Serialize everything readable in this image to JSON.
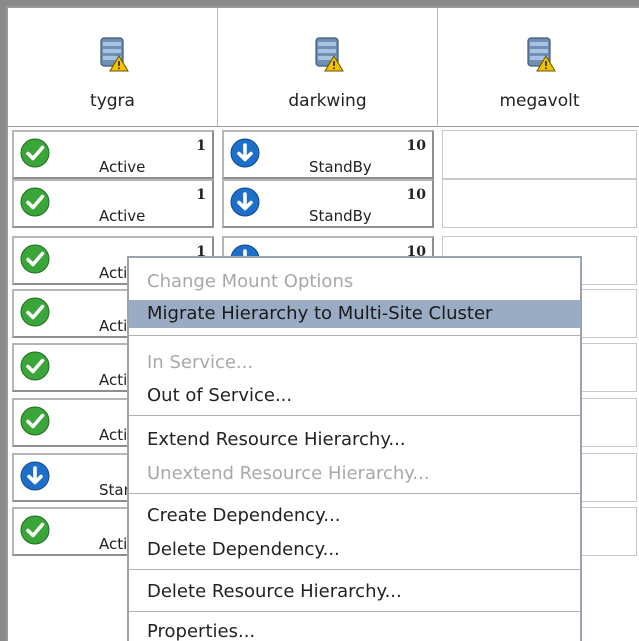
{
  "servers": [
    {
      "name": "tygra",
      "icon": "server-warning-icon"
    },
    {
      "name": "darkwing",
      "icon": "server-warning-icon"
    },
    {
      "name": "megavolt",
      "icon": "server-warning-icon"
    }
  ],
  "rows": [
    {
      "tygra": {
        "state": "Active",
        "priority": "1",
        "icon": "check-icon"
      },
      "darkwing": {
        "state": "StandBy",
        "priority": "10",
        "icon": "arrow-down-icon"
      }
    },
    {
      "tygra": {
        "state": "Active",
        "priority": "1",
        "icon": "check-icon"
      },
      "darkwing": {
        "state": "StandBy",
        "priority": "10",
        "icon": "arrow-down-icon"
      }
    },
    {
      "tygra": {
        "state": "Active",
        "priority": "1",
        "icon": "check-icon"
      },
      "darkwing": {
        "state": "",
        "priority": "10",
        "icon": "arrow-down-icon"
      }
    },
    {
      "tygra": {
        "state": "Active",
        "priority": "",
        "icon": "check-icon"
      }
    },
    {
      "tygra": {
        "state": "Active",
        "priority": "",
        "icon": "check-icon"
      }
    },
    {
      "tygra": {
        "state": "Active",
        "priority": "",
        "icon": "check-icon"
      }
    },
    {
      "tygra": {
        "state": "StandBy",
        "priority": "",
        "icon": "arrow-down-icon"
      }
    },
    {
      "tygra": {
        "state": "Active",
        "priority": "",
        "icon": "check-icon"
      }
    }
  ],
  "context_menu": {
    "items": [
      {
        "label": "Change Mount Options",
        "mnemonic": "",
        "enabled": false,
        "selected": false
      },
      {
        "label": "Migrate Hierarchy to Multi-Site Cluster",
        "mnemonic": "y",
        "enabled": true,
        "selected": true
      },
      {
        "label": "In Service...",
        "mnemonic": "I",
        "enabled": false,
        "selected": false
      },
      {
        "label": "Out of Service...",
        "mnemonic": "O",
        "enabled": true,
        "selected": false
      },
      {
        "label": "Extend Resource Hierarchy...",
        "mnemonic": "E",
        "enabled": true,
        "selected": false
      },
      {
        "label": "Unextend Resource Hierarchy...",
        "mnemonic": "U",
        "enabled": false,
        "selected": false
      },
      {
        "label": "Create Dependency...",
        "mnemonic": "r",
        "enabled": true,
        "selected": false
      },
      {
        "label": "Delete Dependency...",
        "mnemonic": "l",
        "enabled": true,
        "selected": false
      },
      {
        "label": "Delete Resource Hierarchy...",
        "mnemonic": "D",
        "enabled": true,
        "selected": false
      },
      {
        "label": "Properties...",
        "mnemonic": "P",
        "enabled": true,
        "selected": false
      }
    ]
  },
  "colors": {
    "selected_bg": "#9aabc4",
    "active_green": "#3aa63a",
    "standby_blue": "#1d6fc9",
    "disabled_text": "#a8a8a8"
  }
}
